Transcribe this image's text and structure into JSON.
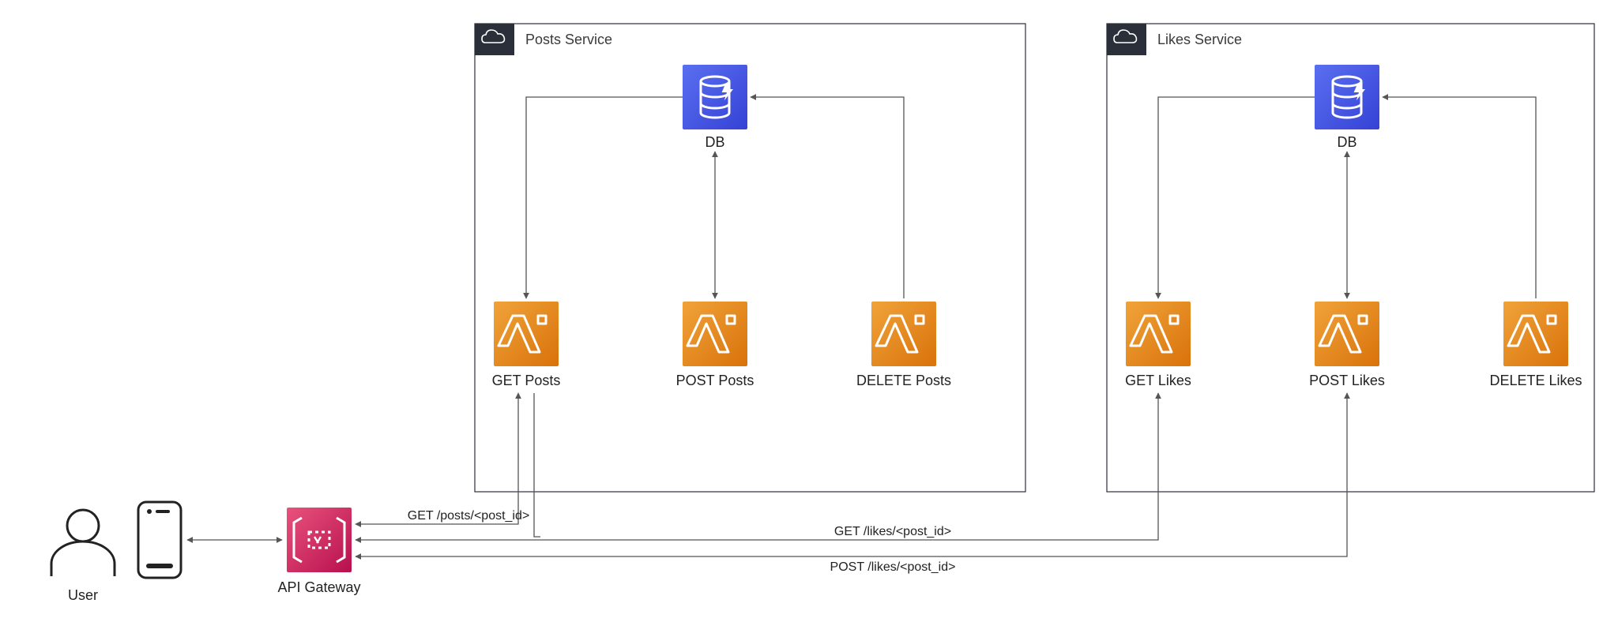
{
  "user": {
    "label": "User"
  },
  "api_gateway": {
    "label": "API Gateway"
  },
  "routes": {
    "get_posts": "GET /posts/<post_id>",
    "get_likes": "GET /likes/<post_id>",
    "post_likes": "POST /likes/<post_id>"
  },
  "posts_service": {
    "title": "Posts Service",
    "db_label": "DB",
    "lambdas": {
      "get": {
        "label": "GET Posts"
      },
      "post": {
        "label": "POST Posts"
      },
      "delete": {
        "label": "DELETE Posts"
      }
    }
  },
  "likes_service": {
    "title": "Likes Service",
    "db_label": "DB",
    "lambdas": {
      "get": {
        "label": "GET Likes"
      },
      "post": {
        "label": "POST Likes"
      },
      "delete": {
        "label": "DELETE Likes"
      }
    }
  }
}
